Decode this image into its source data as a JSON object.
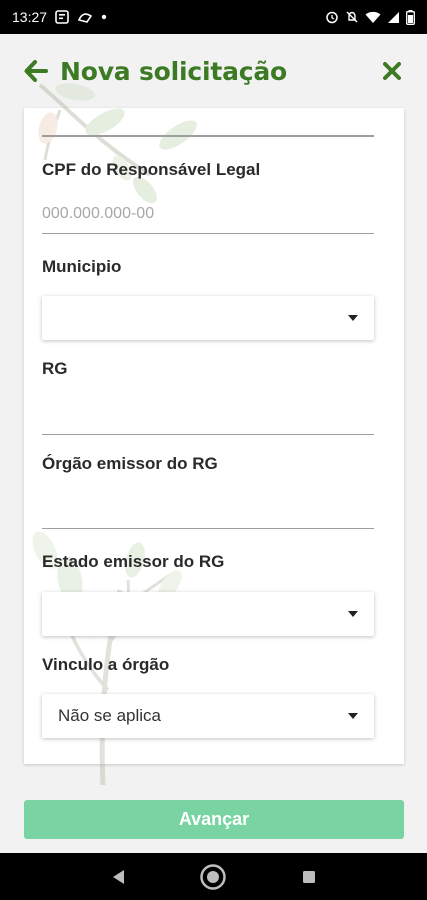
{
  "status_bar": {
    "time": "13:27",
    "left_icons": [
      "message-icon",
      "app-icon",
      "dot-icon"
    ],
    "right_icons": [
      "alarm-icon",
      "mute-icon",
      "wifi-icon",
      "signal-icon",
      "battery-icon"
    ]
  },
  "header": {
    "title": "Nova solicitação",
    "back_icon": "arrow-left-icon",
    "close_icon": "close-icon",
    "accent_color": "#3d7a24"
  },
  "form": {
    "cpf": {
      "label": "CPF do Responsável Legal",
      "placeholder": "000.000.000-00",
      "value": ""
    },
    "municipio": {
      "label": "Municipio",
      "selected": ""
    },
    "rg": {
      "label": "RG",
      "value": ""
    },
    "orgao_emissor": {
      "label": "Órgão emissor do RG",
      "value": ""
    },
    "estado_emissor": {
      "label": "Estado emissor do RG",
      "selected": ""
    },
    "vinculo": {
      "label": "Vinculo a órgão",
      "selected": "Não se aplica"
    }
  },
  "actions": {
    "advance_label": "Avançar",
    "advance_color": "#79d3a2"
  },
  "nav_bar": {
    "buttons": [
      "back-triangle-icon",
      "home-circle-icon",
      "recents-square-icon"
    ]
  }
}
